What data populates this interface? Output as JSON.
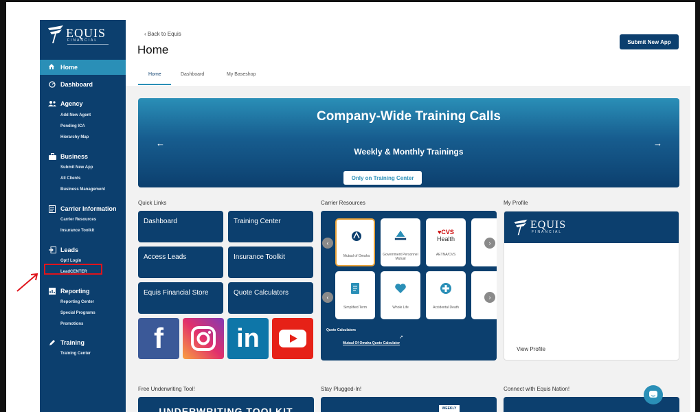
{
  "brand": {
    "logo_word": "EQUIS",
    "logo_sub": "FINANCIAL",
    "colors": {
      "navy": "#0c3f6e",
      "accent": "#2a8fb7",
      "highlight": "#e0141c"
    }
  },
  "sidebar": {
    "home": "Home",
    "dashboard": "Dashboard",
    "agency": {
      "label": "Agency",
      "items": [
        "Add New Agent",
        "Pending ICA",
        "Hierarchy Map"
      ]
    },
    "business": {
      "label": "Business",
      "items": [
        "Submit New App",
        "All Clients",
        "Business Management"
      ]
    },
    "carrier": {
      "label": "Carrier Information",
      "items": [
        "Carrier Resources",
        "Insurance Toolkit"
      ]
    },
    "leads": {
      "label": "Leads",
      "items": [
        "Opt! Login",
        "LeadCENTER"
      ]
    },
    "reporting": {
      "label": "Reporting",
      "items": [
        "Reporting Center",
        "Special Programs",
        "Promotions"
      ]
    },
    "training": {
      "label": "Training",
      "items": [
        "Training Center"
      ]
    }
  },
  "header": {
    "back": "Back to Equis",
    "title": "Home",
    "submit_button": "Submit New App",
    "tabs": [
      "Home",
      "Dashboard",
      "My Baseshop"
    ]
  },
  "banner": {
    "title": "Company-Wide Training Calls",
    "subtitle": "Weekly & Monthly Trainings",
    "button": "Only on Training Center"
  },
  "quick_links": {
    "label": "Quick Links",
    "items": [
      "Dashboard",
      "Training Center",
      "Access Leads",
      "Insurance Toolkit",
      "Equis Financial Store",
      "Quote Calculators"
    ]
  },
  "carrier_resources": {
    "label": "Carrier Resources",
    "row1": [
      "Mutual of Omaha",
      "Government Personnel Mutual",
      "AETNA/CVS"
    ],
    "row2": [
      "Simplified Term",
      "Whole Life",
      "Accidental Death"
    ],
    "cvs_brand": "CVS",
    "cvs_health": "Health",
    "quote_calculators": "Quote Calculators",
    "quote_link": "Mutual Of Omaha Quote Calculator"
  },
  "profile": {
    "label": "My Profile",
    "link": "View Profile"
  },
  "bottom": {
    "underwriting_label": "Free Underwriting Tool!",
    "underwriting_text": "UNDERWRITING TOOLKIT",
    "plugged_label": "Stay Plugged-In!",
    "plugged_badge": "WEEKLY",
    "nation_label": "Connect with Equis Nation!"
  },
  "social": [
    "facebook-icon",
    "instagram-icon",
    "linkedin-icon",
    "youtube-icon"
  ]
}
